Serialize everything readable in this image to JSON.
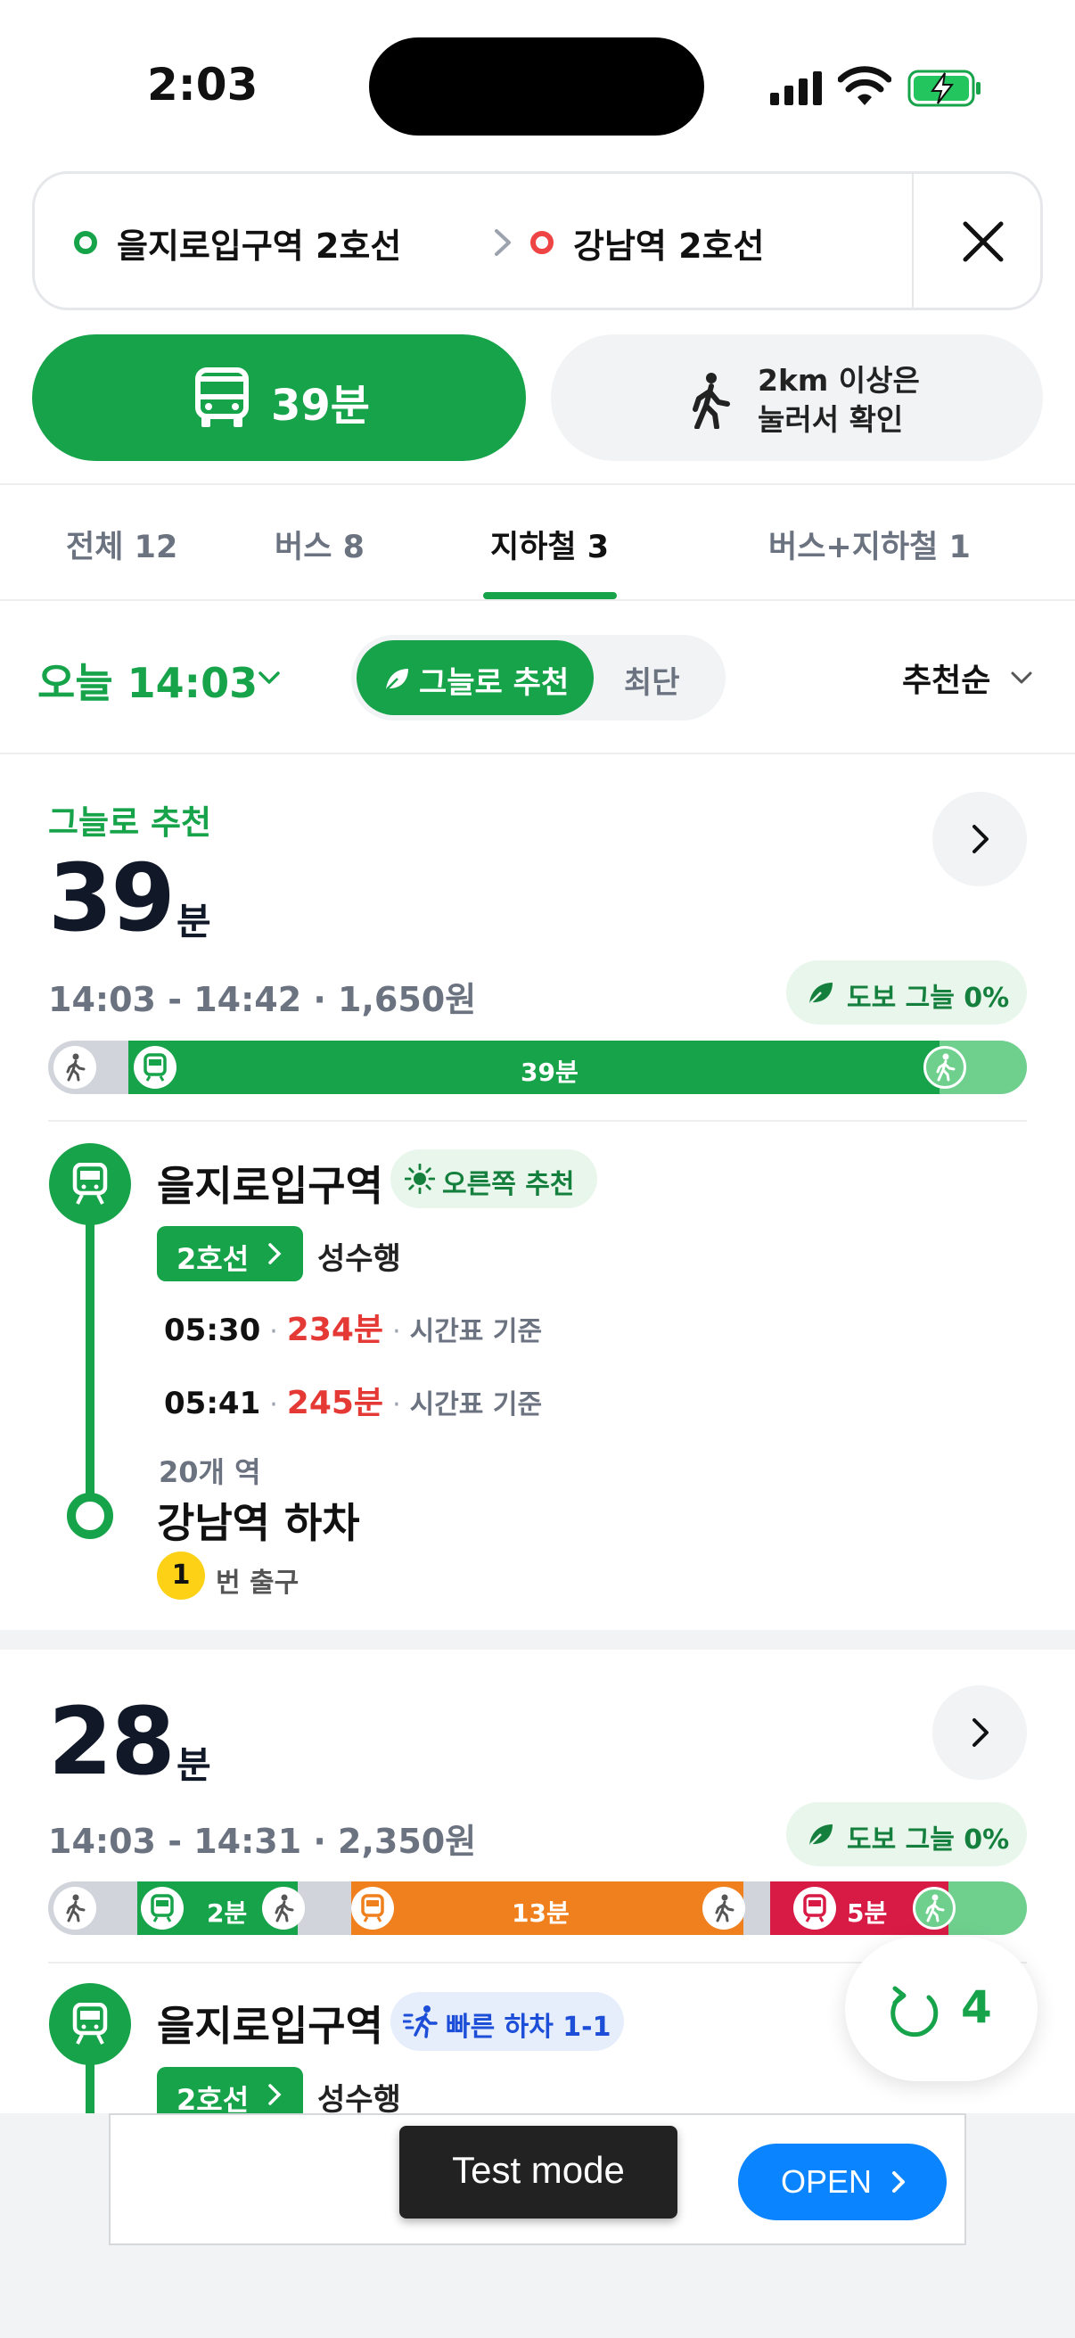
{
  "status": {
    "time": "2:03"
  },
  "route": {
    "from": "을지로입구역 2호선",
    "to": "강남역 2호선"
  },
  "modes": {
    "bus_time": "39분",
    "walk_line1": "2km 이상은",
    "walk_line2": "눌러서 확인"
  },
  "tabs": [
    {
      "label": "전체 12"
    },
    {
      "label": "버스 8"
    },
    {
      "label": "지하철 3"
    },
    {
      "label": "버스+지하철 1"
    }
  ],
  "filters": {
    "time": "오늘 14:03",
    "segment_active": "그늘로 추천",
    "segment_other": "최단",
    "sort": "추천순"
  },
  "routes": [
    {
      "tag": "그늘로 추천",
      "minutes": "39",
      "unit": "분",
      "time_range": "14:03 - 14:42 · 1,650원",
      "shade": "도보 그늘 0%",
      "bar_label": "39분",
      "station": "을지로입구역",
      "pill": "오른쪽 추천",
      "line": "2호선",
      "direction": "성수행",
      "departures": [
        {
          "time": "05:30",
          "wait": "234분",
          "basis": "시간표 기준"
        },
        {
          "time": "05:41",
          "wait": "245분",
          "basis": "시간표 기준"
        }
      ],
      "stops": "20개 역",
      "alight": "강남역 하차",
      "exit_no": "1",
      "exit_label": "번 출구"
    },
    {
      "minutes": "28",
      "unit": "분",
      "time_range": "14:03 - 14:31 · 2,350원",
      "shade": "도보 그늘 0%",
      "bar_labels": [
        "2분",
        "13분",
        "5분"
      ],
      "station": "을지로입구역",
      "pill": "빠른 하차 1-1",
      "line": "2호선",
      "direction": "성수행"
    }
  ],
  "fab": {
    "count": "4"
  },
  "ad": {
    "test_mode": "Test mode",
    "open": "OPEN"
  },
  "colors": {
    "accent": "#16a34a",
    "orange": "#f07f1d",
    "red": "#d81b45",
    "blue": "#0a84ff"
  }
}
